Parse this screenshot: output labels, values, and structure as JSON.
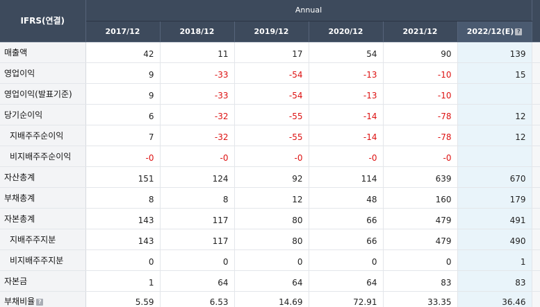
{
  "table": {
    "title": "IFRS(연결)",
    "period_group": "Annual",
    "years": [
      "2017/12",
      "2018/12",
      "2019/12",
      "2020/12",
      "2021/12",
      "2022/12(E)"
    ],
    "help_icon": "question-mark",
    "rows": [
      {
        "label": "매출액",
        "sub": false,
        "values": [
          "42",
          "11",
          "17",
          "54",
          "90",
          "139"
        ]
      },
      {
        "label": "영업이익",
        "sub": false,
        "values": [
          "9",
          "-33",
          "-54",
          "-13",
          "-10",
          "15"
        ]
      },
      {
        "label": "영업이익(발표기준)",
        "sub": false,
        "values": [
          "9",
          "-33",
          "-54",
          "-13",
          "-10",
          ""
        ]
      },
      {
        "label": "당기순이익",
        "sub": false,
        "values": [
          "6",
          "-32",
          "-55",
          "-14",
          "-78",
          "12"
        ]
      },
      {
        "label": "지배주주순이익",
        "sub": true,
        "values": [
          "7",
          "-32",
          "-55",
          "-14",
          "-78",
          "12"
        ]
      },
      {
        "label": "비지배주주순이익",
        "sub": true,
        "values": [
          "-0",
          "-0",
          "-0",
          "-0",
          "-0",
          ""
        ]
      },
      {
        "label": "자산총계",
        "sub": false,
        "values": [
          "151",
          "124",
          "92",
          "114",
          "639",
          "670"
        ]
      },
      {
        "label": "부채총계",
        "sub": false,
        "values": [
          "8",
          "8",
          "12",
          "48",
          "160",
          "179"
        ]
      },
      {
        "label": "자본총계",
        "sub": false,
        "values": [
          "143",
          "117",
          "80",
          "66",
          "479",
          "491"
        ]
      },
      {
        "label": "지배주주지분",
        "sub": true,
        "values": [
          "143",
          "117",
          "80",
          "66",
          "479",
          "490"
        ]
      },
      {
        "label": "비지배주주지분",
        "sub": true,
        "values": [
          "0",
          "0",
          "0",
          "0",
          "0",
          "1"
        ]
      },
      {
        "label": "자본금",
        "sub": false,
        "values": [
          "1",
          "64",
          "64",
          "64",
          "83",
          "83"
        ]
      },
      {
        "label": "부채비율",
        "sub": false,
        "help": true,
        "values": [
          "5.59",
          "6.53",
          "14.69",
          "72.91",
          "33.35",
          "36.46"
        ]
      }
    ],
    "colors": {
      "header_bg": "#3d4a5c",
      "estimate_bg": "#e9f4fa",
      "negative": "#dd1111"
    }
  }
}
